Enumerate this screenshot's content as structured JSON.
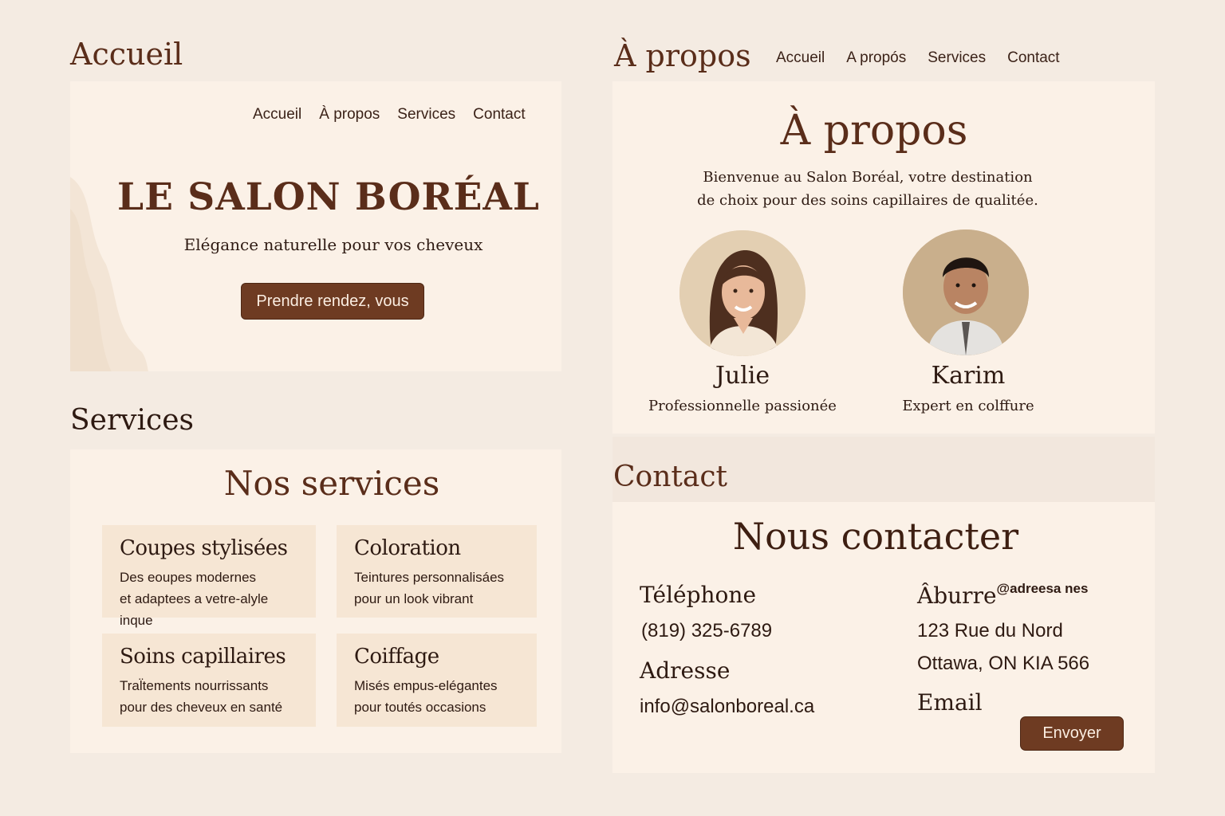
{
  "accueil": {
    "section_label": "Accueil",
    "nav": [
      "Accueil",
      "À propos",
      "Services",
      "Contact"
    ],
    "title": "LE SALON BORÉAL",
    "tagline": "Elégance naturelle pour vos cheveux",
    "cta_label": "Prendre rendez, vous"
  },
  "apropos": {
    "section_label": "À propos",
    "nav": [
      "Accueil",
      "A propós",
      "Services",
      "Contact"
    ],
    "heading": "À propos",
    "intro_line1": "Bienvenue au Salon Boréal, votre destination",
    "intro_line2": "de choix pour des soins capillaires de qualitée.",
    "team": [
      {
        "name": "Julie",
        "role": "Professionnelle passionée",
        "avatar": "woman-portrait"
      },
      {
        "name": "Karim",
        "role": "Expert en colffure",
        "avatar": "man-portrait"
      }
    ]
  },
  "services": {
    "section_label": "Services",
    "heading": "Nos services",
    "items": [
      {
        "title": "Coupes stylisées",
        "line1": "Des eoupes modernes",
        "line2": "et adaptees a vetre-alyle inque"
      },
      {
        "title": "Coloration",
        "line1": "Teintures personnalisáes",
        "line2": "pour un look vibrant"
      },
      {
        "title": "Soins capillaires",
        "line1": "Tral̈tements nourrissants",
        "line2": "pour des cheveux en santé"
      },
      {
        "title": "Coiffage",
        "line1": "Misés empus-elégantes",
        "line2": "pour toutés occasions"
      }
    ]
  },
  "contact": {
    "section_label": "Contact",
    "heading": "Nous contacter",
    "phone_label": "Téléphone",
    "phone_value": "(819) 325-6789",
    "address_label": "Adresse",
    "email_value": "info@salonboreal.ca",
    "extra_label": "Âburre",
    "extra_sup": "@adreesa nes",
    "street": "123 Rue du Nord",
    "city": "Ottawa, ON KIA 566",
    "email_label": "Email",
    "submit_label": "Envoyer"
  },
  "colors": {
    "background": "#f4ebe2",
    "panel": "#fbf1e7",
    "card": "#f6e6d4",
    "accent": "#6e3b22",
    "heading": "#5a2d1a"
  }
}
